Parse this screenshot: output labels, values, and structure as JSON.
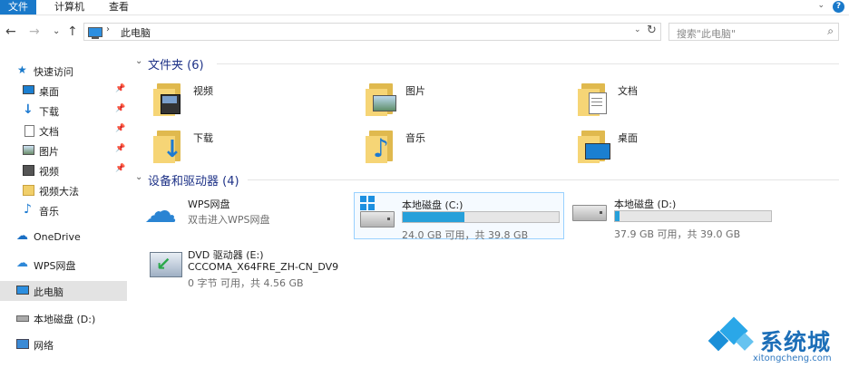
{
  "ribbon": {
    "tabs": [
      "文件",
      "计算机",
      "查看"
    ],
    "help": "?"
  },
  "nav": {
    "back": "←",
    "forward": "→",
    "recent": "⌄",
    "up": "↑"
  },
  "address": {
    "path": "此电脑",
    "sep": "›",
    "drop": "⌄",
    "refresh": "↻"
  },
  "search": {
    "placeholder": "搜索\"此电脑\"",
    "icon": "⌕"
  },
  "sidebar": {
    "quick_access": "快速访问",
    "items": [
      "桌面",
      "下载",
      "文档",
      "图片",
      "视频",
      "视频大法",
      "音乐"
    ],
    "onedrive": "OneDrive",
    "wps": "WPS网盘",
    "thispc": "此电脑",
    "localdisk": "本地磁盘 (D:)",
    "network": "网络"
  },
  "folders_group": {
    "title": "文件夹 (6)",
    "folders": [
      "视频",
      "图片",
      "文档",
      "下载",
      "音乐",
      "桌面"
    ]
  },
  "devices_group": {
    "title": "设备和驱动器 (4)",
    "wps": {
      "name": "WPS网盘",
      "sub": "双击进入WPS网盘"
    },
    "c": {
      "name": "本地磁盘 (C:)",
      "space": "24.0 GB 可用，共 39.8 GB",
      "used_fraction": 0.397
    },
    "d": {
      "name": "本地磁盘 (D:)",
      "space": "37.9 GB 可用，共 39.0 GB",
      "used_fraction": 0.028
    },
    "dvd": {
      "name": "DVD 驱动器 (E:)",
      "label": "CCCOMA_X64FRE_ZH-CN_DV9",
      "space": "0 字节 可用，共 4.56 GB"
    }
  },
  "watermark": {
    "cn": "系统城",
    "en": "xitongcheng.com"
  },
  "colors": {
    "accent": "#1979ca",
    "bar_fill": "#26a0da",
    "group_title": "#1e3287",
    "selection": "#99d1ff"
  }
}
